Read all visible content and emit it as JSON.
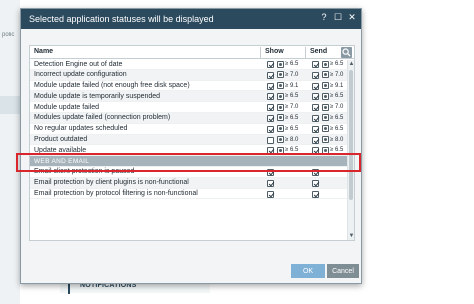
{
  "background": {
    "left_fragment": "polic",
    "notifications_label": "NOTIFICATIONS"
  },
  "dialog": {
    "title": "Selected application statuses will be displayed",
    "controls": {
      "help": "?",
      "maximize": "☐",
      "close": "✕"
    }
  },
  "table": {
    "headers": {
      "name": "Name",
      "show": "Show",
      "send": "Send"
    },
    "rows": [
      {
        "name": "Detection Engine out of date",
        "show_checked": true,
        "show_sev": "≥ 6.5",
        "send_checked": true,
        "send_sev": "≥ 6.5"
      },
      {
        "name": "Incorrect update configuration",
        "show_checked": true,
        "show_sev": "≥ 7.0",
        "send_checked": true,
        "send_sev": "≥ 7.0"
      },
      {
        "name": "Module update failed (not enough free disk space)",
        "show_checked": true,
        "show_sev": "≥ 9.1",
        "send_checked": true,
        "send_sev": "≥ 9.1"
      },
      {
        "name": "Module update is temporarily suspended",
        "show_checked": true,
        "show_sev": "≥ 6.5",
        "send_checked": true,
        "send_sev": "≥ 6.5"
      },
      {
        "name": "Module update failed",
        "show_checked": true,
        "show_sev": "≥ 7.0",
        "send_checked": true,
        "send_sev": "≥ 7.0"
      },
      {
        "name": "Modules update failed (connection problem)",
        "show_checked": true,
        "show_sev": "≥ 6.5",
        "send_checked": true,
        "send_sev": "≥ 6.5"
      },
      {
        "name": "No regular updates scheduled",
        "show_checked": true,
        "show_sev": "≥ 6.5",
        "send_checked": true,
        "send_sev": "≥ 6.5"
      },
      {
        "name": "Product outdated",
        "show_checked": false,
        "show_sev": "≥ 8.0",
        "send_checked": true,
        "send_sev": "≥ 8.0"
      },
      {
        "name": "Update available",
        "show_checked": true,
        "show_sev": "≥ 6.5",
        "send_checked": true,
        "send_sev": "≥ 6.5"
      },
      {
        "section": true,
        "name": "WEB AND EMAIL"
      },
      {
        "name": "Email client protection is paused",
        "show_checked": true,
        "show_sev": "",
        "send_checked": true,
        "send_sev": ""
      },
      {
        "name": "Email protection by client plugins is non-functional",
        "show_checked": true,
        "show_sev": "",
        "send_checked": true,
        "send_sev": ""
      },
      {
        "name": "Email protection by protocol filtering is non-functional",
        "show_checked": true,
        "show_sev": "",
        "send_checked": true,
        "send_sev": ""
      }
    ]
  },
  "buttons": {
    "ok": "OK",
    "cancel": "Cancel"
  },
  "colors": {
    "titlebar": "#2c4a5e",
    "highlight": "#d9262c",
    "ok": "#7fb0d6",
    "cancel": "#7f8d95"
  },
  "icons": {
    "search": "search-icon",
    "severity": "severity-icon",
    "scroll_up": "chevron-up-icon",
    "scroll_down": "chevron-down-icon"
  }
}
